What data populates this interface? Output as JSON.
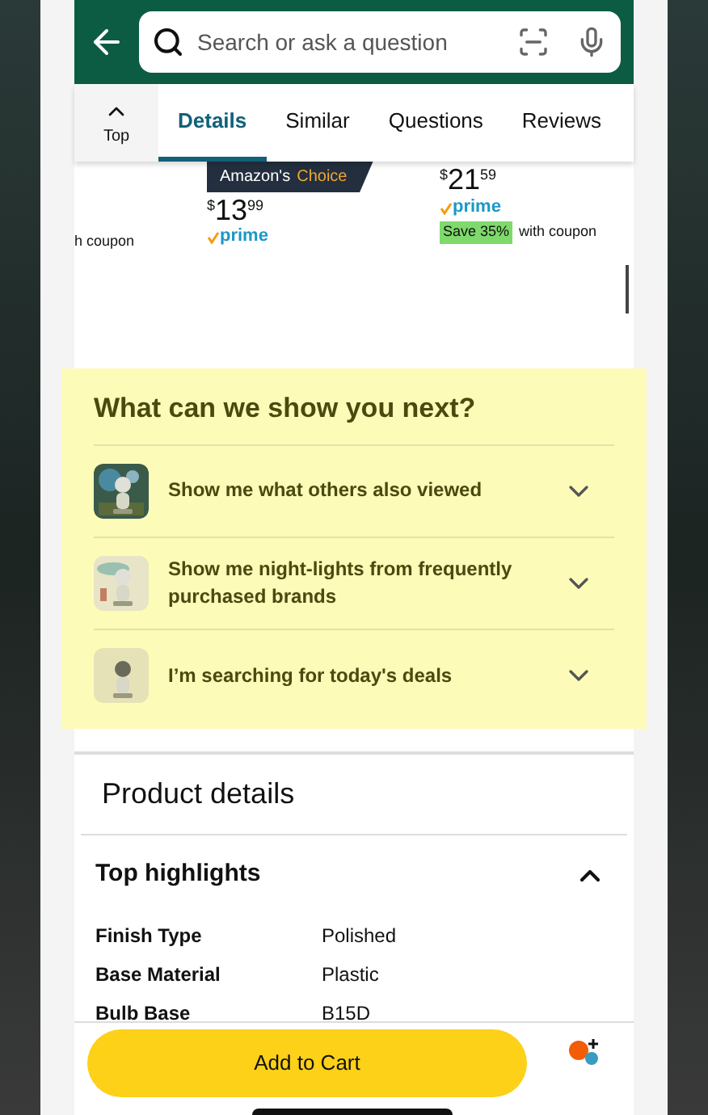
{
  "search": {
    "placeholder": "Search or ask a question"
  },
  "top_button": {
    "label": "Top"
  },
  "tabs": [
    {
      "label": "Details",
      "selected": true
    },
    {
      "label": "Similar",
      "selected": false
    },
    {
      "label": "Questions",
      "selected": false
    },
    {
      "label": "Reviews",
      "selected": false
    }
  ],
  "products": [
    {
      "coupon": "h coupon"
    },
    {
      "badge": [
        "Amazon's",
        "Choice"
      ],
      "price": {
        "symbol": "$",
        "whole": "13",
        "fraction": "99"
      },
      "prime": "prime"
    },
    {
      "price": {
        "symbol": "$",
        "whole": "21",
        "fraction": "59"
      },
      "prime": "prime",
      "save": "Save 35%",
      "coupon": "with coupon"
    }
  ],
  "suggestions": {
    "title": "What can we show you next?",
    "items": [
      {
        "label": "Show me what others also viewed",
        "expanded": false
      },
      {
        "label": "Show me night-lights from frequently purchased brands",
        "expanded": false
      },
      {
        "label": "I’m searching for today's deals",
        "expanded": false
      }
    ]
  },
  "product_details": {
    "title": "Product details"
  },
  "top_highlights": {
    "title": "Top highlights",
    "expanded": true,
    "rows": [
      {
        "name": "Finish Type",
        "value": "Polished"
      },
      {
        "name": "Base Material",
        "value": "Plastic"
      },
      {
        "name": "Bulb Base",
        "value": "B15D"
      }
    ]
  },
  "add_to_cart": {
    "label": "Add to Cart"
  }
}
